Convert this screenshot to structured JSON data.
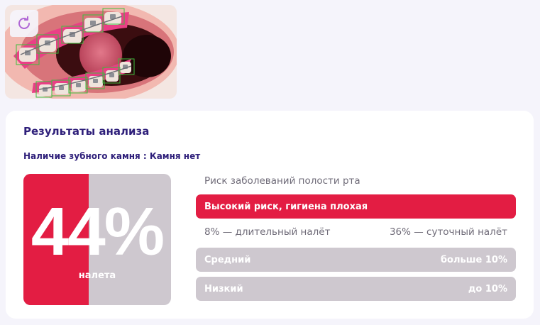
{
  "photo": {
    "alt": "teeth analysis photo",
    "refresh_icon": "refresh-icon",
    "colors": {
      "accent": "#b068d6",
      "detection_box": "#3dbb3d",
      "stain": "#e6327a"
    }
  },
  "results": {
    "title": "Результаты анализа",
    "calculus_text": "Наличие зубного камня : Камня нет",
    "plaque": {
      "percent_text": "44%",
      "percent_value": 44,
      "label": "налета",
      "colors": {
        "fill": "#e31d43",
        "rest": "#cec8cf"
      }
    },
    "risk": {
      "title": "Риск заболеваний полости рта",
      "high": {
        "label": "Высокий риск, гигиена плохая"
      },
      "long_term": "8% — длительный налёт",
      "daily": "36% — суточный налёт",
      "medium": {
        "label": "Средний",
        "range": "больше 10%"
      },
      "low": {
        "label": "Низкий",
        "range": "до 10%"
      }
    }
  }
}
